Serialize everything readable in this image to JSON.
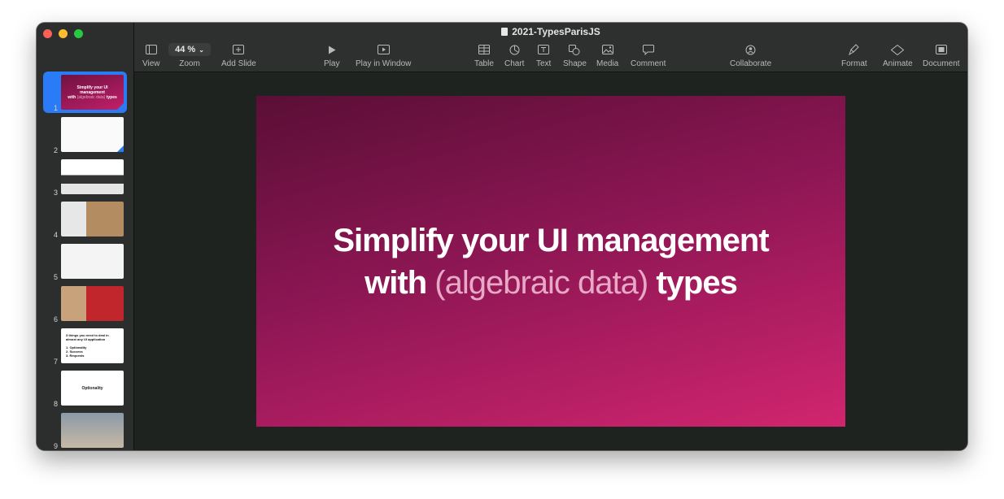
{
  "window": {
    "title": "2021-TypesParisJS"
  },
  "toolbar": {
    "zoom_value": "44 %",
    "items": {
      "view": "View",
      "zoom": "Zoom",
      "add_slide": "Add Slide",
      "play": "Play",
      "play_in_window": "Play in Window",
      "table": "Table",
      "chart": "Chart",
      "text": "Text",
      "shape": "Shape",
      "media": "Media",
      "comment": "Comment",
      "collaborate": "Collaborate",
      "format": "Format",
      "animate": "Animate",
      "document": "Document"
    }
  },
  "slide": {
    "line1": "Simplify your UI management",
    "line2_a": "with ",
    "line2_thin": "(algebraic data)",
    "line2_b": " types"
  },
  "thumbnails": {
    "t1": {
      "line1": "Simplify your UI management",
      "line2_a": "with ",
      "line2_thin": "(algebraic data)",
      "line2_b": " types"
    },
    "t7": {
      "line1": "3 things you need to deal in",
      "line2": "almost any UI application",
      "item1": "1. Optionality",
      "item2": "2. Success",
      "item3": "3. Requests"
    },
    "t8": {
      "title": "Optionality"
    }
  },
  "slide_numbers": [
    "1",
    "2",
    "3",
    "4",
    "5",
    "6",
    "7",
    "8",
    "9"
  ],
  "colors": {
    "accent": "#2a7cf6",
    "slide_gradient_start": "#5a0f36",
    "slide_gradient_end": "#d1256f"
  }
}
